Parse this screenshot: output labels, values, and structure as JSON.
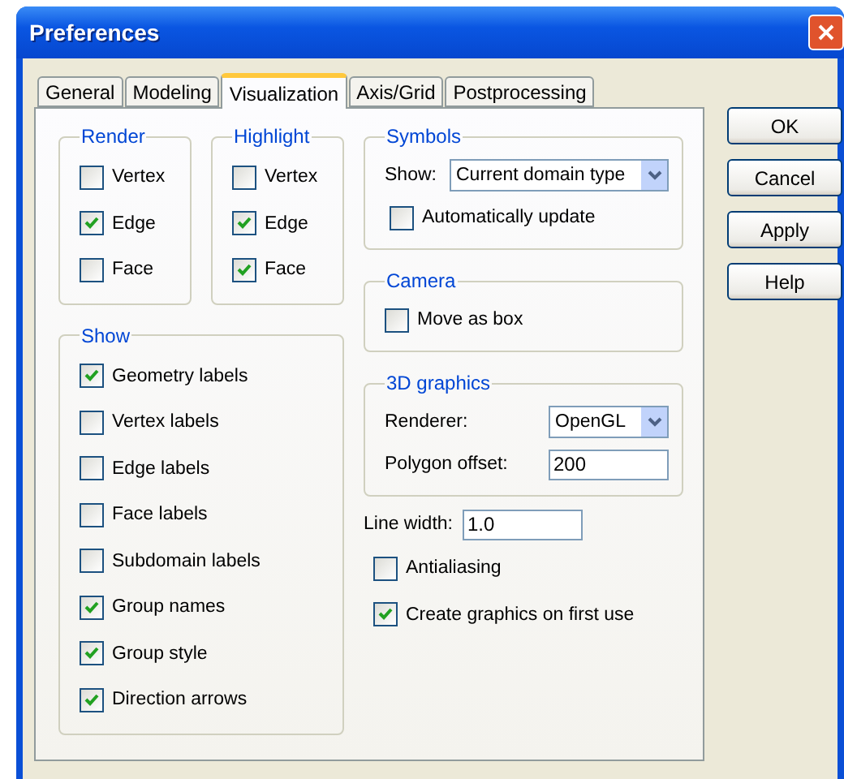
{
  "window": {
    "title": "Preferences"
  },
  "tabs": [
    {
      "label": "General",
      "selected": false
    },
    {
      "label": "Modeling",
      "selected": false
    },
    {
      "label": "Visualization",
      "selected": true
    },
    {
      "label": "Axis/Grid",
      "selected": false
    },
    {
      "label": "Postprocessing",
      "selected": false
    }
  ],
  "render": {
    "title": "Render",
    "items": [
      {
        "label": "Vertex",
        "checked": false
      },
      {
        "label": "Edge",
        "checked": true
      },
      {
        "label": "Face",
        "checked": false
      }
    ]
  },
  "highlight": {
    "title": "Highlight",
    "items": [
      {
        "label": "Vertex",
        "checked": false
      },
      {
        "label": "Edge",
        "checked": true
      },
      {
        "label": "Face",
        "checked": true
      }
    ]
  },
  "show": {
    "title": "Show",
    "items": [
      {
        "label": "Geometry labels",
        "checked": true
      },
      {
        "label": "Vertex labels",
        "checked": false
      },
      {
        "label": "Edge labels",
        "checked": false
      },
      {
        "label": "Face labels",
        "checked": false
      },
      {
        "label": "Subdomain labels",
        "checked": false
      },
      {
        "label": "Group names",
        "checked": true
      },
      {
        "label": "Group style",
        "checked": true
      },
      {
        "label": "Direction arrows",
        "checked": true
      }
    ]
  },
  "symbols": {
    "title": "Symbols",
    "show_label": "Show:",
    "show_value": "Current domain type",
    "auto_update": {
      "label": "Automatically update",
      "checked": false
    }
  },
  "camera": {
    "title": "Camera",
    "move_as_box": {
      "label": "Move as box",
      "checked": false
    }
  },
  "graphics": {
    "title": "3D graphics",
    "renderer_label": "Renderer:",
    "renderer_value": "OpenGL",
    "offset_label": "Polygon offset:",
    "offset_value": "200"
  },
  "line_width": {
    "label": "Line width:",
    "value": "1.0"
  },
  "options": [
    {
      "label": "Antialiasing",
      "checked": false
    },
    {
      "label": "Create graphics on first use",
      "checked": true
    }
  ],
  "buttons": [
    "OK",
    "Cancel",
    "Apply",
    "Help"
  ]
}
